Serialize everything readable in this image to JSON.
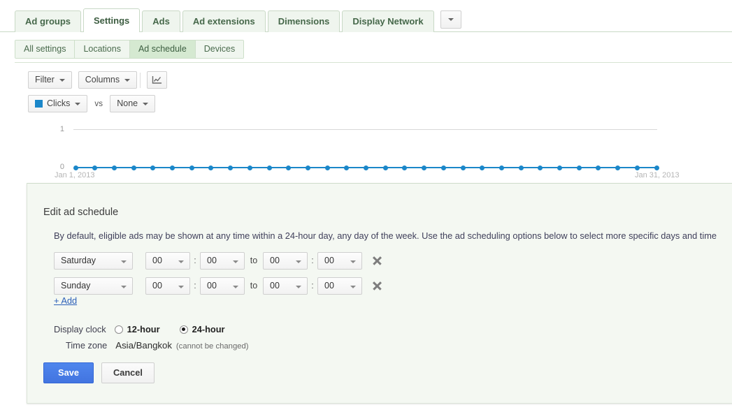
{
  "colors": {
    "accent_blue": "#1b87c9",
    "tab_green_bg": "#eff5ee",
    "tab_green_border": "#c9d9c6",
    "subtab_active_bg": "#d5e9d1",
    "panel_bg": "#f4f8f2",
    "save_blue": "#4274e0",
    "link_blue": "#2b5fb8"
  },
  "tabs": {
    "items": [
      {
        "label": "Ad groups",
        "active": false
      },
      {
        "label": "Settings",
        "active": true
      },
      {
        "label": "Ads",
        "active": false
      },
      {
        "label": "Ad extensions",
        "active": false
      },
      {
        "label": "Dimensions",
        "active": false
      },
      {
        "label": "Display Network",
        "active": false
      }
    ],
    "more_icon": "chevron-down-icon"
  },
  "subtabs": {
    "items": [
      {
        "label": "All settings",
        "active": false
      },
      {
        "label": "Locations",
        "active": false
      },
      {
        "label": "Ad schedule",
        "active": true
      },
      {
        "label": "Devices",
        "active": false
      }
    ]
  },
  "toolbar": {
    "filter_label": "Filter",
    "columns_label": "Columns",
    "chart_icon": "line-chart-icon",
    "metric_label": "Clicks",
    "vs_label": "vs",
    "compare_label": "None"
  },
  "chart_data": {
    "type": "line",
    "title": "",
    "xlabel": "",
    "ylabel": "",
    "ylim": [
      0,
      1
    ],
    "ytick_labels": [
      "1",
      "0"
    ],
    "xtick_labels": [
      "Jan 1, 2013",
      "Jan 31, 2013"
    ],
    "grid": true,
    "legend_position": "top-left",
    "series": [
      {
        "name": "Clicks",
        "color": "#1b87c9",
        "x": [
          "Jan 1, 2013",
          "Jan 2, 2013",
          "Jan 3, 2013",
          "Jan 4, 2013",
          "Jan 5, 2013",
          "Jan 6, 2013",
          "Jan 7, 2013",
          "Jan 8, 2013",
          "Jan 9, 2013",
          "Jan 10, 2013",
          "Jan 11, 2013",
          "Jan 12, 2013",
          "Jan 13, 2013",
          "Jan 14, 2013",
          "Jan 15, 2013",
          "Jan 16, 2013",
          "Jan 17, 2013",
          "Jan 18, 2013",
          "Jan 19, 2013",
          "Jan 20, 2013",
          "Jan 21, 2013",
          "Jan 22, 2013",
          "Jan 23, 2013",
          "Jan 24, 2013",
          "Jan 25, 2013",
          "Jan 26, 2013",
          "Jan 27, 2013",
          "Jan 28, 2013",
          "Jan 29, 2013",
          "Jan 30, 2013",
          "Jan 31, 2013"
        ],
        "values": [
          0,
          0,
          0,
          0,
          0,
          0,
          0,
          0,
          0,
          0,
          0,
          0,
          0,
          0,
          0,
          0,
          0,
          0,
          0,
          0,
          0,
          0,
          0,
          0,
          0,
          0,
          0,
          0,
          0,
          0,
          0
        ]
      }
    ]
  },
  "panel": {
    "title": "Edit ad schedule",
    "description": "By default, eligible ads may be shown at any time within a 24-hour day, any day of the week. Use the ad scheduling options below to select more specific days and time",
    "rows": [
      {
        "day": "Saturday",
        "start_hour": "00",
        "start_minute": "00",
        "to_label": "to",
        "end_hour": "00",
        "end_minute": "00",
        "colon": ":",
        "remove_icon": "close-icon"
      },
      {
        "day": "Sunday",
        "start_hour": "00",
        "start_minute": "00",
        "to_label": "to",
        "end_hour": "00",
        "end_minute": "00",
        "colon": ":",
        "remove_icon": "close-icon"
      }
    ],
    "add_label": "+ Add",
    "display_clock_label": "Display clock",
    "clock_options": [
      {
        "label": "12-hour",
        "selected": false
      },
      {
        "label": "24-hour",
        "selected": true
      }
    ],
    "timezone_label": "Time zone",
    "timezone_value": "Asia/Bangkok",
    "timezone_note": "(cannot be changed)",
    "save_label": "Save",
    "cancel_label": "Cancel"
  }
}
